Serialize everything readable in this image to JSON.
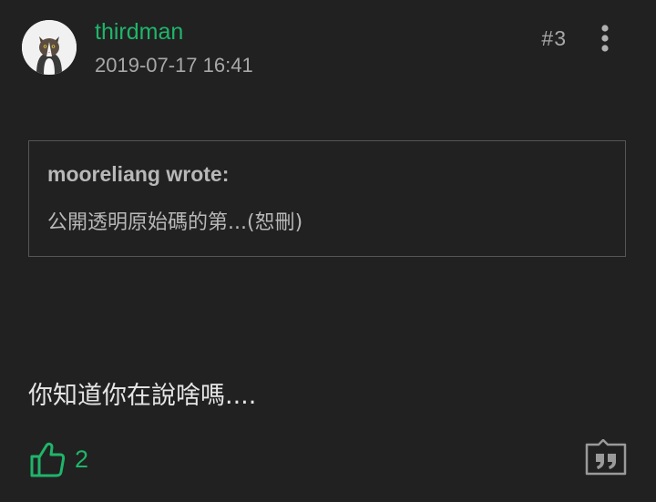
{
  "post": {
    "author": "thirdman",
    "timestamp": "2019-07-17 16:41",
    "number": "#3",
    "quote": {
      "author_line": "mooreliang wrote:",
      "text": "公開透明原始碼的第...(恕刪)"
    },
    "body": "你知道你在說啥嗎....",
    "likes": "2"
  },
  "icons": {
    "avatar": "cat-avatar",
    "menu": "more-vertical-icon",
    "like": "thumbs-up-icon",
    "quote": "quote-reply-icon"
  },
  "colors": {
    "background": "#212121",
    "accent": "#1fb56a",
    "muted_text": "#a8a8a8",
    "border": "#555555"
  }
}
